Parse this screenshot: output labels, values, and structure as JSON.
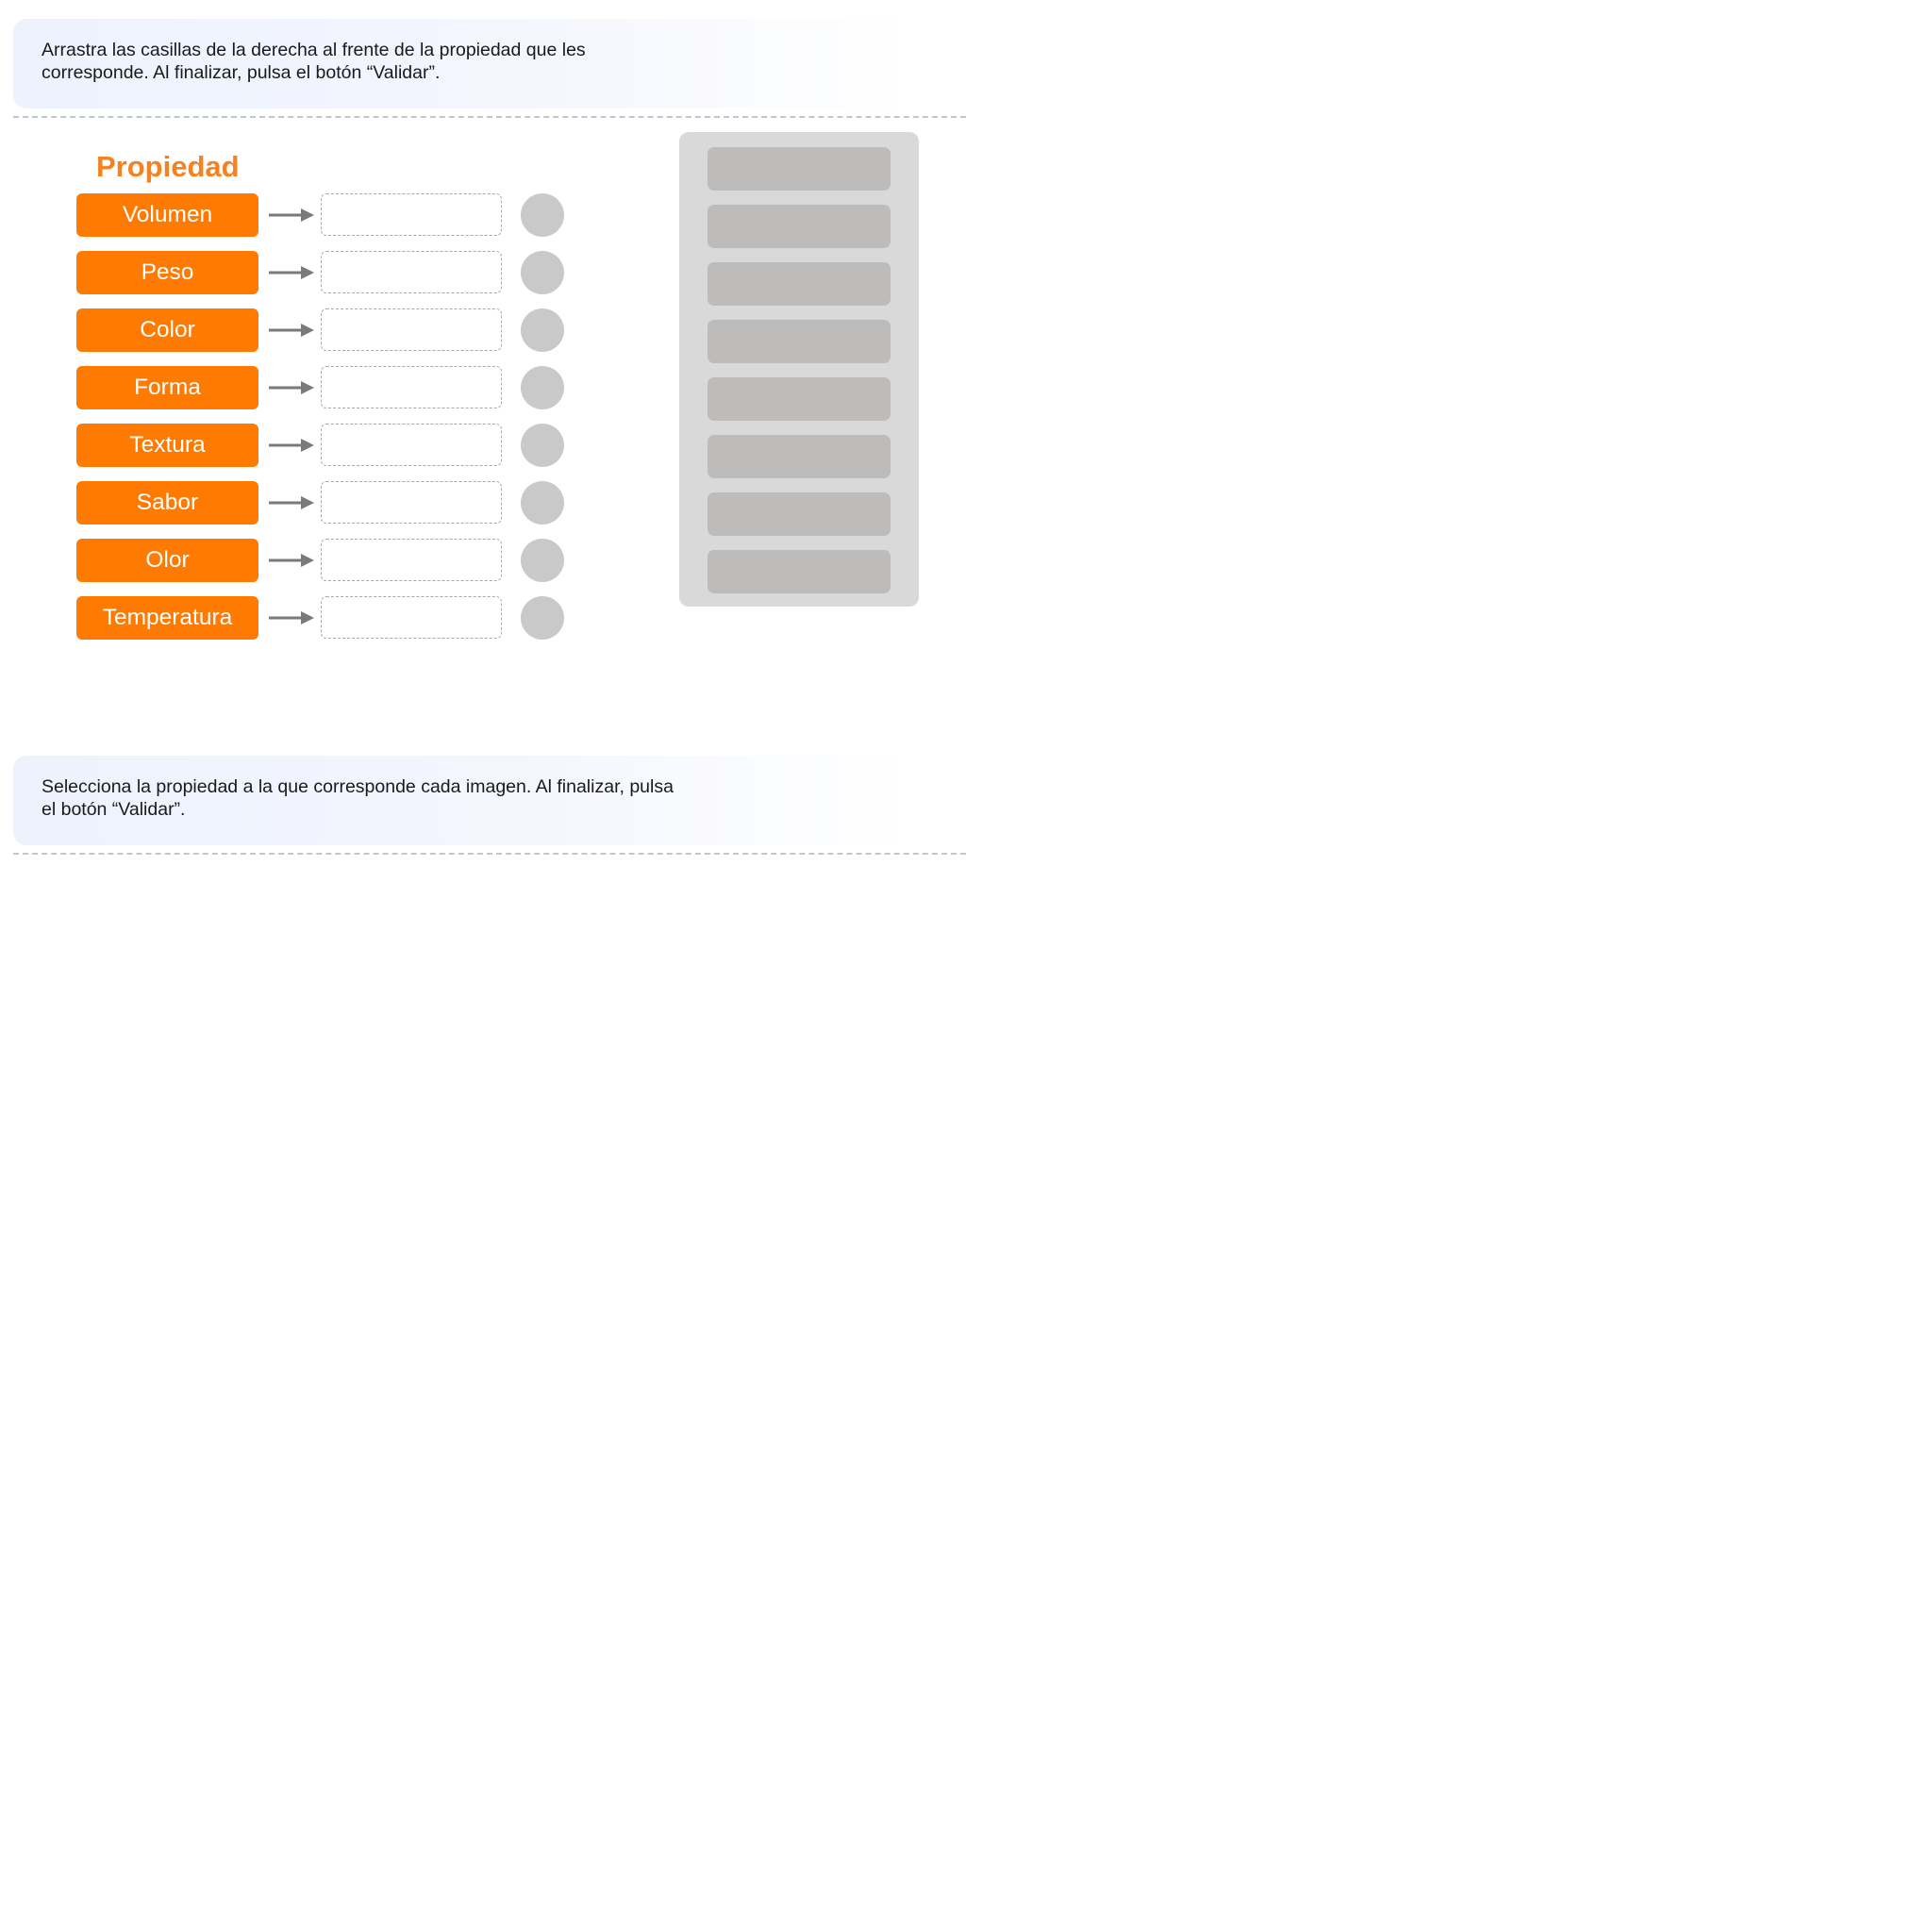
{
  "exercise1": {
    "instruction": "Arrastra las casillas de la derecha al frente de la propiedad que les\ncorresponde. Al finalizar, pulsa el botón “Validar”.",
    "column_header": "Propiedad",
    "properties": [
      {
        "label": "Volumen"
      },
      {
        "label": "Peso"
      },
      {
        "label": "Color"
      },
      {
        "label": "Forma"
      },
      {
        "label": "Textura"
      },
      {
        "label": "Sabor"
      },
      {
        "label": "Olor"
      },
      {
        "label": "Temperatura"
      }
    ]
  },
  "exercise2": {
    "instruction": "Selecciona la propiedad a la que corresponde cada imagen. Al finalizar, pulsa\nel botón “Validar”."
  },
  "colors": {
    "accent_orange": "#ff7a00",
    "header_orange": "#f58220",
    "status_gray": "#c9c9c9",
    "card_gray": "#bebbbb",
    "bank_gray": "#d9d9d9"
  }
}
